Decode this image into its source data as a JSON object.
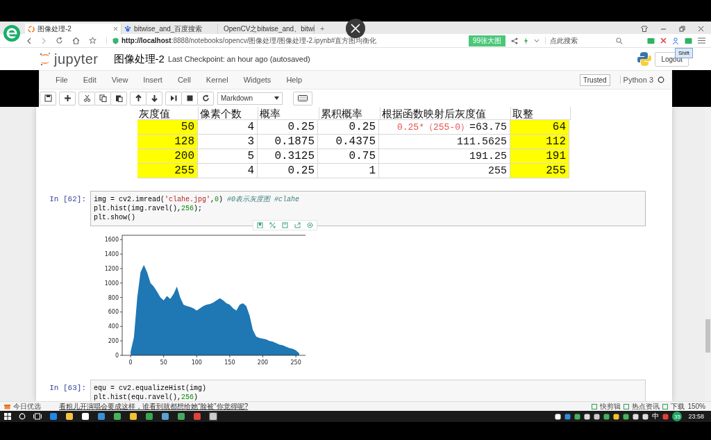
{
  "browser": {
    "tabs": [
      {
        "title": "图像处理-2",
        "selected": true
      },
      {
        "title": "bitwise_and_百度搜索",
        "selected": false
      },
      {
        "title": "OpenCV之bitwise_and、bitwi",
        "selected": false
      }
    ],
    "new_tab": "+",
    "url_host": "http://localhost",
    "url_rest": ":8888/notebooks/opencv/图像处理/图像处理-2.ipynb#直方图均衡化",
    "promo": "99张大图",
    "search_placeholder": "点此搜索"
  },
  "jupyter": {
    "logo_text": "jupyter",
    "title": "图像处理-2",
    "checkpoint": "Last Checkpoint: an hour ago (autosaved)",
    "logout": "Logout",
    "overlay_label": "Shift",
    "menu": [
      "File",
      "Edit",
      "View",
      "Insert",
      "Cell",
      "Kernel",
      "Widgets",
      "Help"
    ],
    "trusted": "Trusted",
    "kernel": "Python 3",
    "kernel_busy": false,
    "cell_type": "Markdown"
  },
  "table": {
    "columns": [
      {
        "label": "灰度值",
        "highlight": true
      },
      {
        "label": "像素个数",
        "highlight": false
      },
      {
        "label": "概率",
        "highlight": false
      },
      {
        "label": "累积概率",
        "highlight": false
      },
      {
        "label": "根据函数映射后灰度值",
        "highlight": false
      },
      {
        "label": "取整",
        "highlight": true
      }
    ],
    "rows": [
      [
        [
          {
            "text": "50",
            "kind": "plain"
          }
        ],
        [
          {
            "text": "4",
            "kind": "plain"
          }
        ],
        [
          {
            "text": "0.25",
            "kind": "plain"
          }
        ],
        [
          {
            "text": "0.25",
            "kind": "plain"
          }
        ],
        [
          {
            "text": "0.25*（255-0）",
            "kind": "formula"
          },
          {
            "text": "=63.75",
            "kind": "plain"
          }
        ],
        [
          {
            "text": "64",
            "kind": "plain"
          }
        ]
      ],
      [
        [
          {
            "text": "128",
            "kind": "plain"
          }
        ],
        [
          {
            "text": "3",
            "kind": "plain"
          }
        ],
        [
          {
            "text": "0.1875",
            "kind": "plain"
          }
        ],
        [
          {
            "text": "0.4375",
            "kind": "plain"
          }
        ],
        [
          {
            "text": "111.5625",
            "kind": "plain"
          }
        ],
        [
          {
            "text": "112",
            "kind": "plain"
          }
        ]
      ],
      [
        [
          {
            "text": "200",
            "kind": "plain"
          }
        ],
        [
          {
            "text": "5",
            "kind": "plain"
          }
        ],
        [
          {
            "text": "0.3125",
            "kind": "plain"
          }
        ],
        [
          {
            "text": "0.75",
            "kind": "plain"
          }
        ],
        [
          {
            "text": "191.25",
            "kind": "plain"
          }
        ],
        [
          {
            "text": "191",
            "kind": "plain"
          }
        ]
      ],
      [
        [
          {
            "text": "255",
            "kind": "plain"
          }
        ],
        [
          {
            "text": "4",
            "kind": "plain"
          }
        ],
        [
          {
            "text": "0.25",
            "kind": "plain"
          }
        ],
        [
          {
            "text": "1",
            "kind": "plain"
          }
        ],
        [
          {
            "text": "255",
            "kind": "plain"
          }
        ],
        [
          {
            "text": "255",
            "kind": "plain"
          }
        ]
      ]
    ]
  },
  "cells": [
    {
      "prompt": "In [62]:",
      "selected": true,
      "lines": [
        [
          {
            "text": "img = cv2.imread(",
            "kind": "plain"
          },
          {
            "text": "'clahe.jpg'",
            "kind": "string"
          },
          {
            "text": ",",
            "kind": "plain"
          },
          {
            "text": "0",
            "kind": "number"
          },
          {
            "text": ") ",
            "kind": "plain"
          },
          {
            "text": "#0表示灰度图 #clahe",
            "kind": "comment"
          }
        ],
        [
          {
            "text": "plt.hist(img.ravel(),",
            "kind": "plain"
          },
          {
            "text": "256",
            "kind": "number"
          },
          {
            "text": ");",
            "kind": "plain"
          }
        ],
        [
          {
            "text": "plt.show()",
            "kind": "plain"
          }
        ]
      ],
      "output": {
        "chart_data": {
          "type": "area",
          "x": [
            0,
            5,
            10,
            15,
            20,
            25,
            30,
            35,
            40,
            45,
            50,
            55,
            60,
            65,
            70,
            75,
            80,
            85,
            90,
            95,
            100,
            105,
            110,
            115,
            120,
            125,
            130,
            135,
            140,
            145,
            150,
            155,
            160,
            165,
            170,
            175,
            180,
            185,
            190,
            195,
            200,
            205,
            210,
            215,
            220,
            225,
            230,
            235,
            240,
            245,
            250,
            255
          ],
          "series": [
            {
              "color": "#1f77b4",
              "values": [
                50,
                250,
                800,
                1150,
                1250,
                1150,
                1000,
                950,
                880,
                800,
                760,
                820,
                780,
                850,
                950,
                800,
                700,
                680,
                670,
                650,
                620,
                650,
                680,
                700,
                710,
                730,
                760,
                790,
                760,
                720,
                700,
                650,
                620,
                700,
                720,
                680,
                550,
                350,
                260,
                240,
                230,
                220,
                200,
                190,
                170,
                150,
                140,
                120,
                100,
                90,
                70,
                30
              ]
            }
          ],
          "xlim": [
            -12.75,
            267.75
          ],
          "ylim": [
            0,
            1660
          ],
          "xticks": [
            0,
            50,
            100,
            150,
            200,
            250
          ],
          "yticks": [
            0,
            200,
            400,
            600,
            800,
            1000,
            1200,
            1400,
            1600
          ]
        }
      }
    },
    {
      "prompt": "In [63]:",
      "selected": false,
      "lines": [
        [
          {
            "text": "equ = cv2.equalizeHist(img)",
            "kind": "plain"
          }
        ],
        [
          {
            "text": "plt.hist(equ.ravel(),",
            "kind": "plain"
          },
          {
            "text": "256",
            "kind": "number"
          },
          {
            "text": ")",
            "kind": "plain"
          }
        ]
      ]
    }
  ],
  "status_bar": {
    "left_label": "今日优选",
    "news": "看粗儿开演唱会要成这样，谁看到就都想给她“脸被”你觉得呢?",
    "items": [
      "快剪辑",
      "热点资讯",
      "下载"
    ],
    "zoom": "150%"
  },
  "taskbar": {
    "ime": "中",
    "badge": "35",
    "time": "23:58"
  }
}
